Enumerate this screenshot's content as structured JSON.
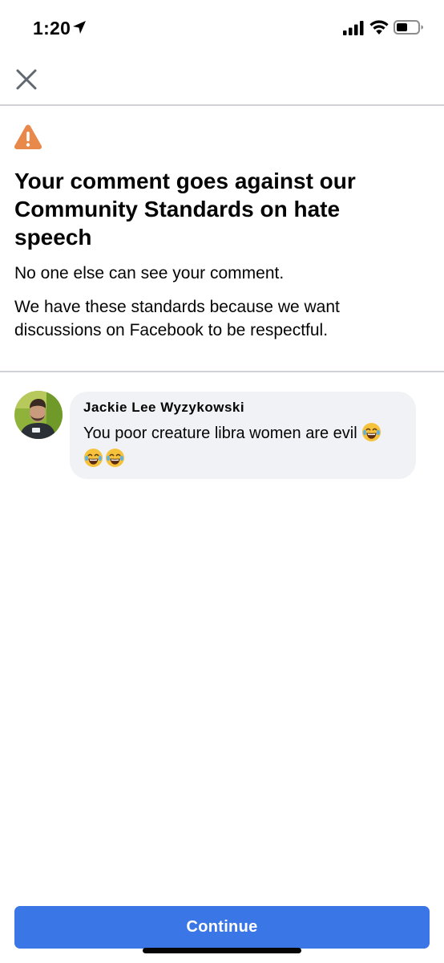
{
  "status_bar": {
    "time": "1:20",
    "icons": [
      "location-arrow-icon",
      "signal-icon",
      "wifi-icon",
      "battery-icon"
    ]
  },
  "header": {
    "close_icon": "close-icon"
  },
  "notice": {
    "icon": "warning-icon",
    "icon_color": "#e8884a",
    "title": "Your comment goes against our Community Standards on hate speech",
    "line1": "No one else can see your comment.",
    "line2": "We have these standards because we want discussions on Facebook to be respectful."
  },
  "comment": {
    "author": "Jackie Lee Wyzykowski",
    "text": "You poor creature libra women are evil",
    "emojis": [
      "face-with-tears-of-joy",
      "face-with-tears-of-joy",
      "face-with-tears-of-joy"
    ]
  },
  "footer": {
    "continue_label": "Continue",
    "button_color": "#3a76e6"
  }
}
